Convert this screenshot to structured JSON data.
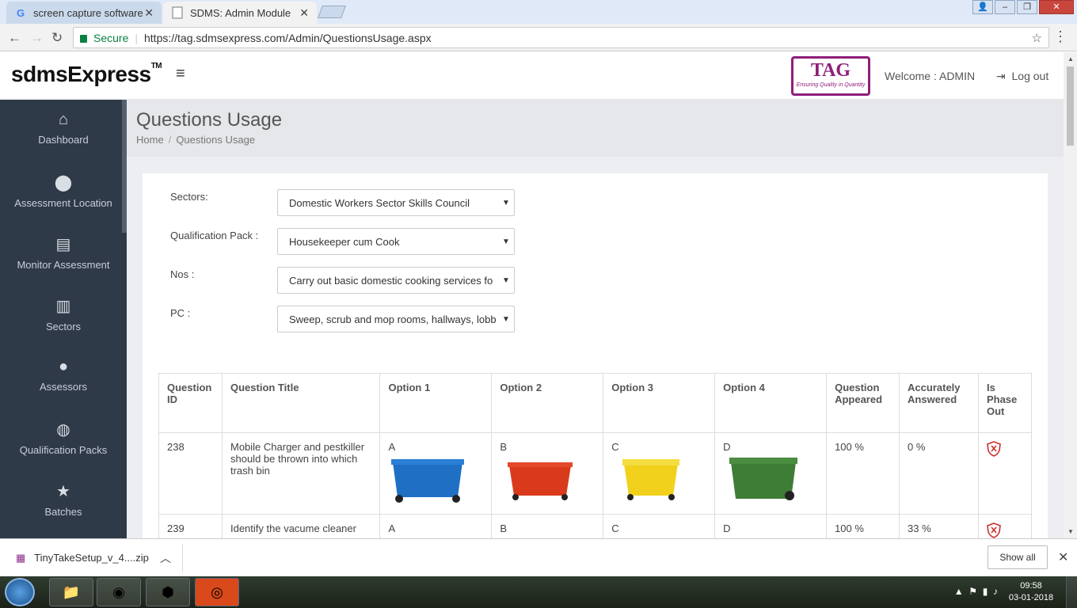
{
  "browser": {
    "tabs": [
      {
        "title": "screen capture software",
        "favicon": "G"
      },
      {
        "title": "SDMS: Admin Module"
      }
    ],
    "secure_label": "Secure",
    "url": "https://tag.sdmsexpress.com/Admin/QuestionsUsage.aspx"
  },
  "header": {
    "logo_text": "sdmsExpress",
    "logo_tm": "TM",
    "partner_logo_text": "TAG",
    "partner_logo_tagline": "Ensuring Quality in Quantity",
    "welcome": "Welcome : ADMIN",
    "logout": "Log out"
  },
  "sidebar": {
    "items": [
      {
        "label": "Dashboard",
        "icon": "home-icon"
      },
      {
        "label": "Assessment Location",
        "icon": "map-marker-icon"
      },
      {
        "label": "Monitor Assessment",
        "icon": "list-icon"
      },
      {
        "label": "Sectors",
        "icon": "bank-icon"
      },
      {
        "label": "Assessors",
        "icon": "user-icon"
      },
      {
        "label": "Qualification Packs",
        "icon": "globe-icon"
      },
      {
        "label": "Batches",
        "icon": "star-icon"
      }
    ]
  },
  "page": {
    "title": "Questions Usage",
    "breadcrumb": [
      "Home",
      "Questions Usage"
    ]
  },
  "filters": [
    {
      "label": "Sectors:",
      "value": "Domestic Workers Sector Skills Council"
    },
    {
      "label": "Qualification Pack :",
      "value": "Housekeeper cum Cook"
    },
    {
      "label": "Nos :",
      "value": "Carry out basic domestic cooking services fo"
    },
    {
      "label": "PC :",
      "value": "Sweep, scrub and mop rooms, hallways, lobb"
    }
  ],
  "table": {
    "headers": [
      "Question ID",
      "Question Title",
      "Option 1",
      "Option 2",
      "Option 3",
      "Option 4",
      "Question Appeared",
      "Accurately Answered",
      "Is Phase Out"
    ],
    "rows": [
      {
        "id": "238",
        "title": "Mobile Charger and pestkiller should be thrown into which trash bin",
        "options": [
          "A",
          "B",
          "C",
          "D"
        ],
        "option_colors": [
          "#1f6fc4",
          "#d93a1c",
          "#f2d11c",
          "#3e7d35"
        ],
        "appeared": "100 %",
        "accurate": "0 %"
      },
      {
        "id": "239",
        "title": "Identify the vacume cleaner",
        "options": [
          "A",
          "B",
          "C",
          "D"
        ],
        "appeared": "100 %",
        "accurate": "33 %"
      }
    ]
  },
  "downloads": {
    "file": "TinyTakeSetup_v_4....zip",
    "show_all": "Show all"
  },
  "taskbar": {
    "time": "09:58",
    "date": "03-01-2018"
  }
}
